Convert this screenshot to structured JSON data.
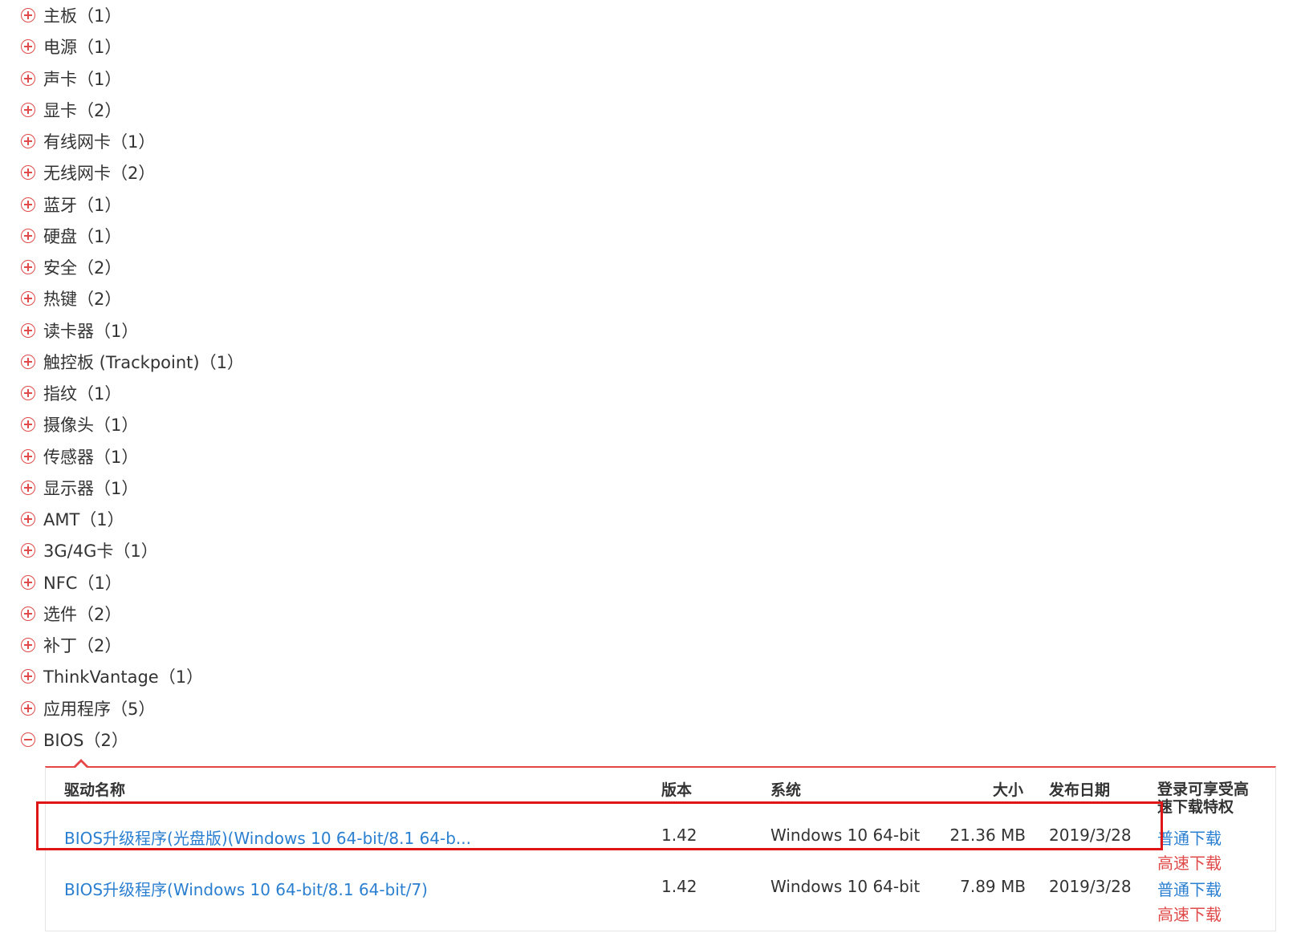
{
  "categories": [
    {
      "label": "主板（1）"
    },
    {
      "label": "电源（1）"
    },
    {
      "label": "声卡（1）"
    },
    {
      "label": "显卡（2）"
    },
    {
      "label": "有线网卡（1）"
    },
    {
      "label": "无线网卡（2）"
    },
    {
      "label": "蓝牙（1）"
    },
    {
      "label": "硬盘（1）"
    },
    {
      "label": "安全（2）"
    },
    {
      "label": "热键（2）"
    },
    {
      "label": "读卡器（1）"
    },
    {
      "label": "触控板 (Trackpoint)（1）"
    },
    {
      "label": "指纹（1）"
    },
    {
      "label": "摄像头（1）"
    },
    {
      "label": "传感器（1）"
    },
    {
      "label": "显示器（1）"
    },
    {
      "label": "AMT（1）"
    },
    {
      "label": "3G/4G卡（1）"
    },
    {
      "label": "NFC（1）"
    },
    {
      "label": "选件（2）"
    },
    {
      "label": "补丁（2）"
    },
    {
      "label": "ThinkVantage（1）"
    },
    {
      "label": "应用程序（5）"
    },
    {
      "label": "BIOS（2）",
      "expanded": true
    }
  ],
  "table": {
    "headers": {
      "name": "驱动名称",
      "version": "版本",
      "system": "系统",
      "size": "大小",
      "date": "发布日期",
      "privilege": "登录可享受高速下载特权"
    },
    "rows": [
      {
        "name": "BIOS升级程序(光盘版)(Windows 10 64-bit/8.1 64-b...",
        "version": "1.42",
        "system": "Windows 10 64-bit",
        "size": "21.36 MB",
        "date": "2019/3/28",
        "normal_download": "普通下载",
        "fast_download": "高速下载"
      },
      {
        "name": "BIOS升级程序(Windows 10 64-bit/8.1 64-bit/7)",
        "version": "1.42",
        "system": "Windows 10 64-bit",
        "size": "7.89 MB",
        "date": "2019/3/28",
        "normal_download": "普通下载",
        "fast_download": "高速下载"
      }
    ]
  },
  "colors": {
    "accent_red": "#e04a4a",
    "link_blue": "#2b7fd0",
    "highlight_red": "#e01515"
  }
}
